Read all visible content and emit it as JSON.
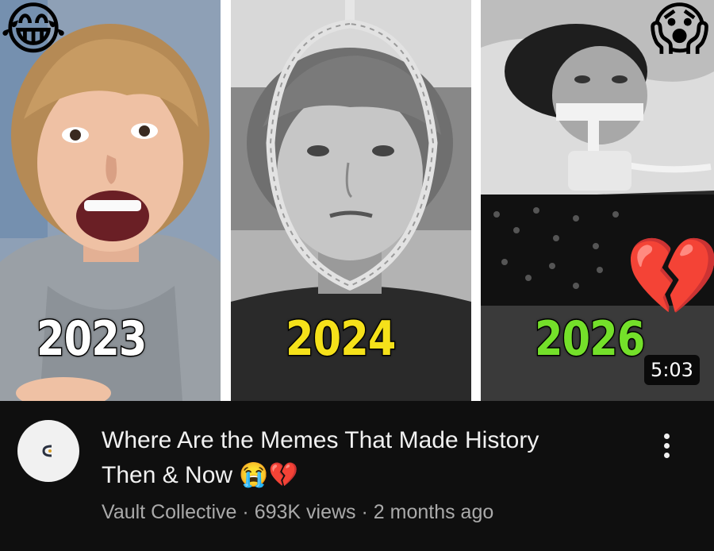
{
  "thumbnail": {
    "years": [
      "2023",
      "2024",
      "2026"
    ],
    "year_colors": [
      "#ffffff",
      "#f5e11a",
      "#74e02a"
    ],
    "duration": "5:03",
    "emojis": {
      "top_left": "😂",
      "top_right": "😱",
      "right_middle": "💔"
    },
    "icons": {
      "top_left": "laughing-emoji-icon",
      "top_right": "shocked-emoji-icon",
      "right_middle": "broken-heart-icon"
    }
  },
  "video": {
    "title_line1": "Where Are the Memes That Made History",
    "title_line2": "Then & Now",
    "title_emojis": "😭💔",
    "channel": "Vault Collective",
    "views": "693K views",
    "age": "2 months ago",
    "separator": "·"
  }
}
